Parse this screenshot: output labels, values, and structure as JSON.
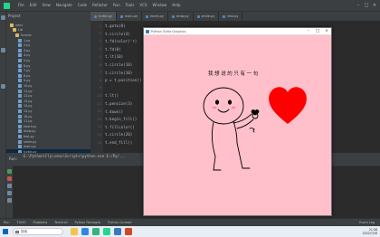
{
  "ide": {
    "menu": [
      "File",
      "Edit",
      "View",
      "Navigate",
      "Code",
      "Refactor",
      "Run",
      "Tools",
      "VCS",
      "Window",
      "Help"
    ],
    "tabs": [
      "turtle.py",
      "main.py",
      "heart.py",
      "draw.py",
      "smile.py",
      "test.py"
    ],
    "project_header": "Project",
    "tree": [
      "venv",
      "Lib",
      "Scripts",
      "1.py",
      "2.py",
      "3.py",
      "4.py",
      "5.py",
      "6.py",
      "7.py",
      "8.py",
      "9.py",
      "10.py",
      "11.py",
      "12.py",
      "13.py",
      "14.py",
      "15.py",
      "16.py",
      "17.py",
      "heart.py",
      "draw.py",
      "test.py",
      "smile.py",
      "main.py",
      "turtle.py"
    ],
    "code_lines": [
      "t.goto(0)",
      "t.circle(4)",
      "t.fd(color('r)",
      "t.fd(0)",
      "t.lt(10)",
      "t.circle(10)",
      "t.circle(10)",
      "p = t.position()",
      "",
      "t.lt()",
      "t.pensize(3)",
      "t.down()",
      "t.begin_fill()",
      "t.fillcolor()",
      "t.circle(20)",
      "t.end_fill()"
    ],
    "line_numbers": [
      "1",
      "2",
      "3",
      "4",
      "5",
      "6",
      "7",
      "8",
      "9",
      "10",
      "11",
      "12",
      "13",
      "14",
      "15",
      "16"
    ],
    "run_label": "Run:",
    "run_command": "E:\\Python\\Fly\\venv\\Scripts\\python.exe E:/Py/...",
    "status_items": [
      "Run",
      "TODO",
      "Problems",
      "Terminal",
      "Python Packages",
      "Python Console"
    ],
    "status_right": "Event Log"
  },
  "taskbar": {
    "search_placeholder": "搜索",
    "time": "21:58",
    "date": "2022/7/26"
  },
  "turtle_window": {
    "title": "Python Turtle Graphics",
    "text": "我想说的只有一句",
    "heart_color": "#ff0000",
    "background": "#ffc0cb"
  }
}
